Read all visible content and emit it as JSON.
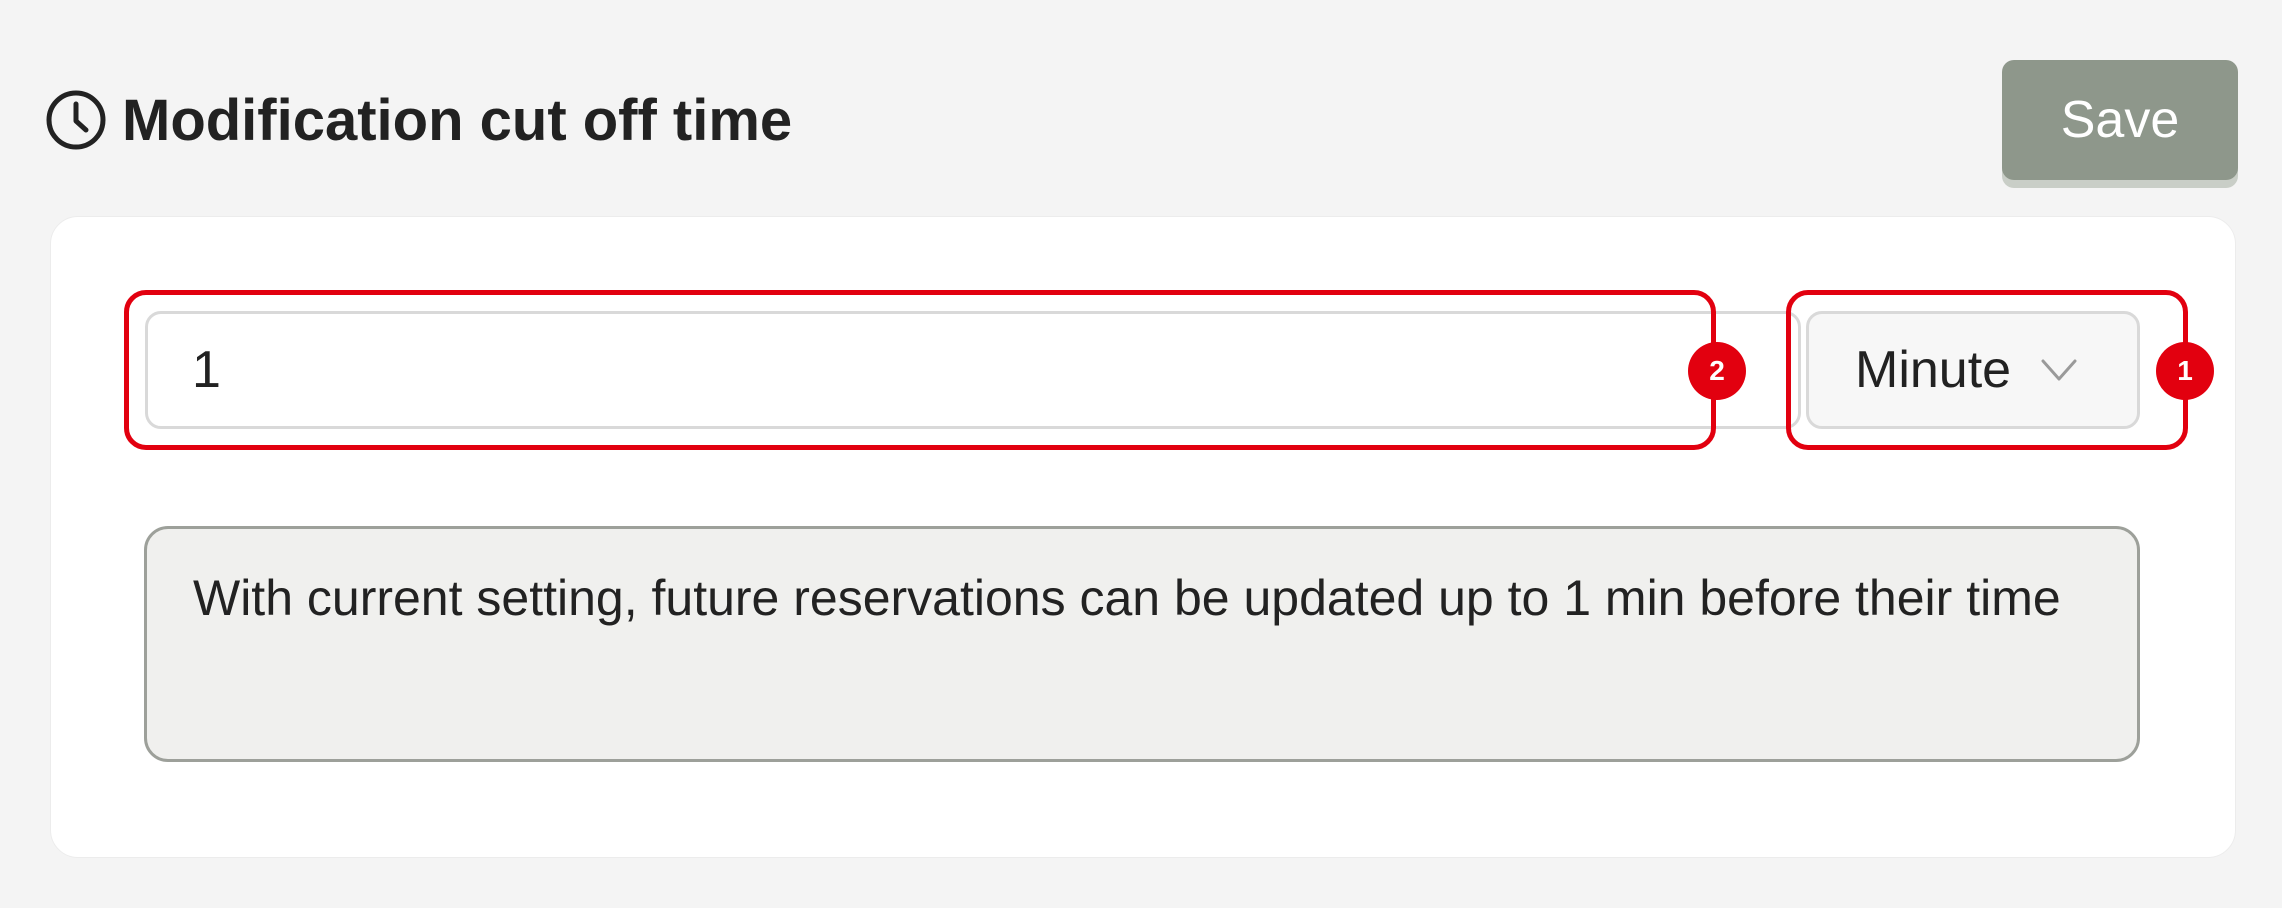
{
  "header": {
    "title": "Modification cut off time",
    "icon": "clock-icon"
  },
  "toolbar": {
    "save_label": "Save",
    "save_color": "#8e978b"
  },
  "cutoff": {
    "value": "1",
    "unit": "Minute",
    "unit_icon": "chevron-down-icon"
  },
  "info": {
    "text": "With current setting, future reservations can be updated up to 1 min before their time"
  },
  "annotations": [
    {
      "label": "1",
      "target": "unit-select"
    },
    {
      "label": "2",
      "target": "value-input"
    }
  ],
  "colors": {
    "annotation": "#e2000f",
    "background": "#f4f4f4",
    "card": "#ffffff"
  }
}
